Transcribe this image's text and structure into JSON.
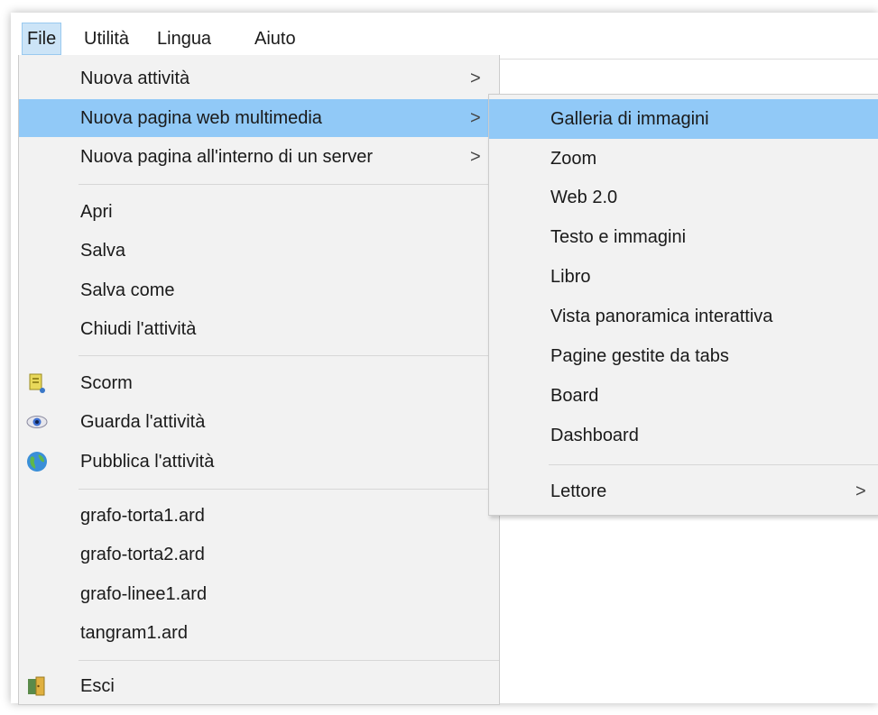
{
  "menubar": {
    "file": "File",
    "utilita": "Utilità",
    "lingua": "Lingua",
    "aiuto": "Aiuto"
  },
  "file_menu": {
    "nuova_attivita": "Nuova attività",
    "nuova_pagina_web": "Nuova pagina web multimedia",
    "nuova_pagina_server": "Nuova pagina all'interno di un server",
    "apri": "Apri",
    "salva": "Salva",
    "salva_come": "Salva come",
    "chiudi": "Chiudi l'attività",
    "scorm": "Scorm",
    "guarda": "Guarda l'attività",
    "pubblica": "Pubblica l'attività",
    "recent1": "grafo-torta1.ard",
    "recent2": "grafo-torta2.ard",
    "recent3": "grafo-linee1.ard",
    "recent4": "tangram1.ard",
    "esci": "Esci",
    "arrow": ">"
  },
  "submenu": {
    "galleria": "Galleria di immagini",
    "zoom": "Zoom",
    "web20": "Web 2.0",
    "testo": "Testo e immagini",
    "libro": "Libro",
    "vista": "Vista panoramica interattiva",
    "pagine_tabs": "Pagine gestite da tabs",
    "board": "Board",
    "dashboard": "Dashboard",
    "lettore": "Lettore",
    "arrow": ">"
  },
  "colors": {
    "highlight": "#91c9f7",
    "menu_bg": "#f2f2f2",
    "menubar_active": "#cce4f7"
  },
  "icons": [
    "scorm-icon",
    "eye-icon",
    "globe-icon",
    "exit-door-icon"
  ]
}
